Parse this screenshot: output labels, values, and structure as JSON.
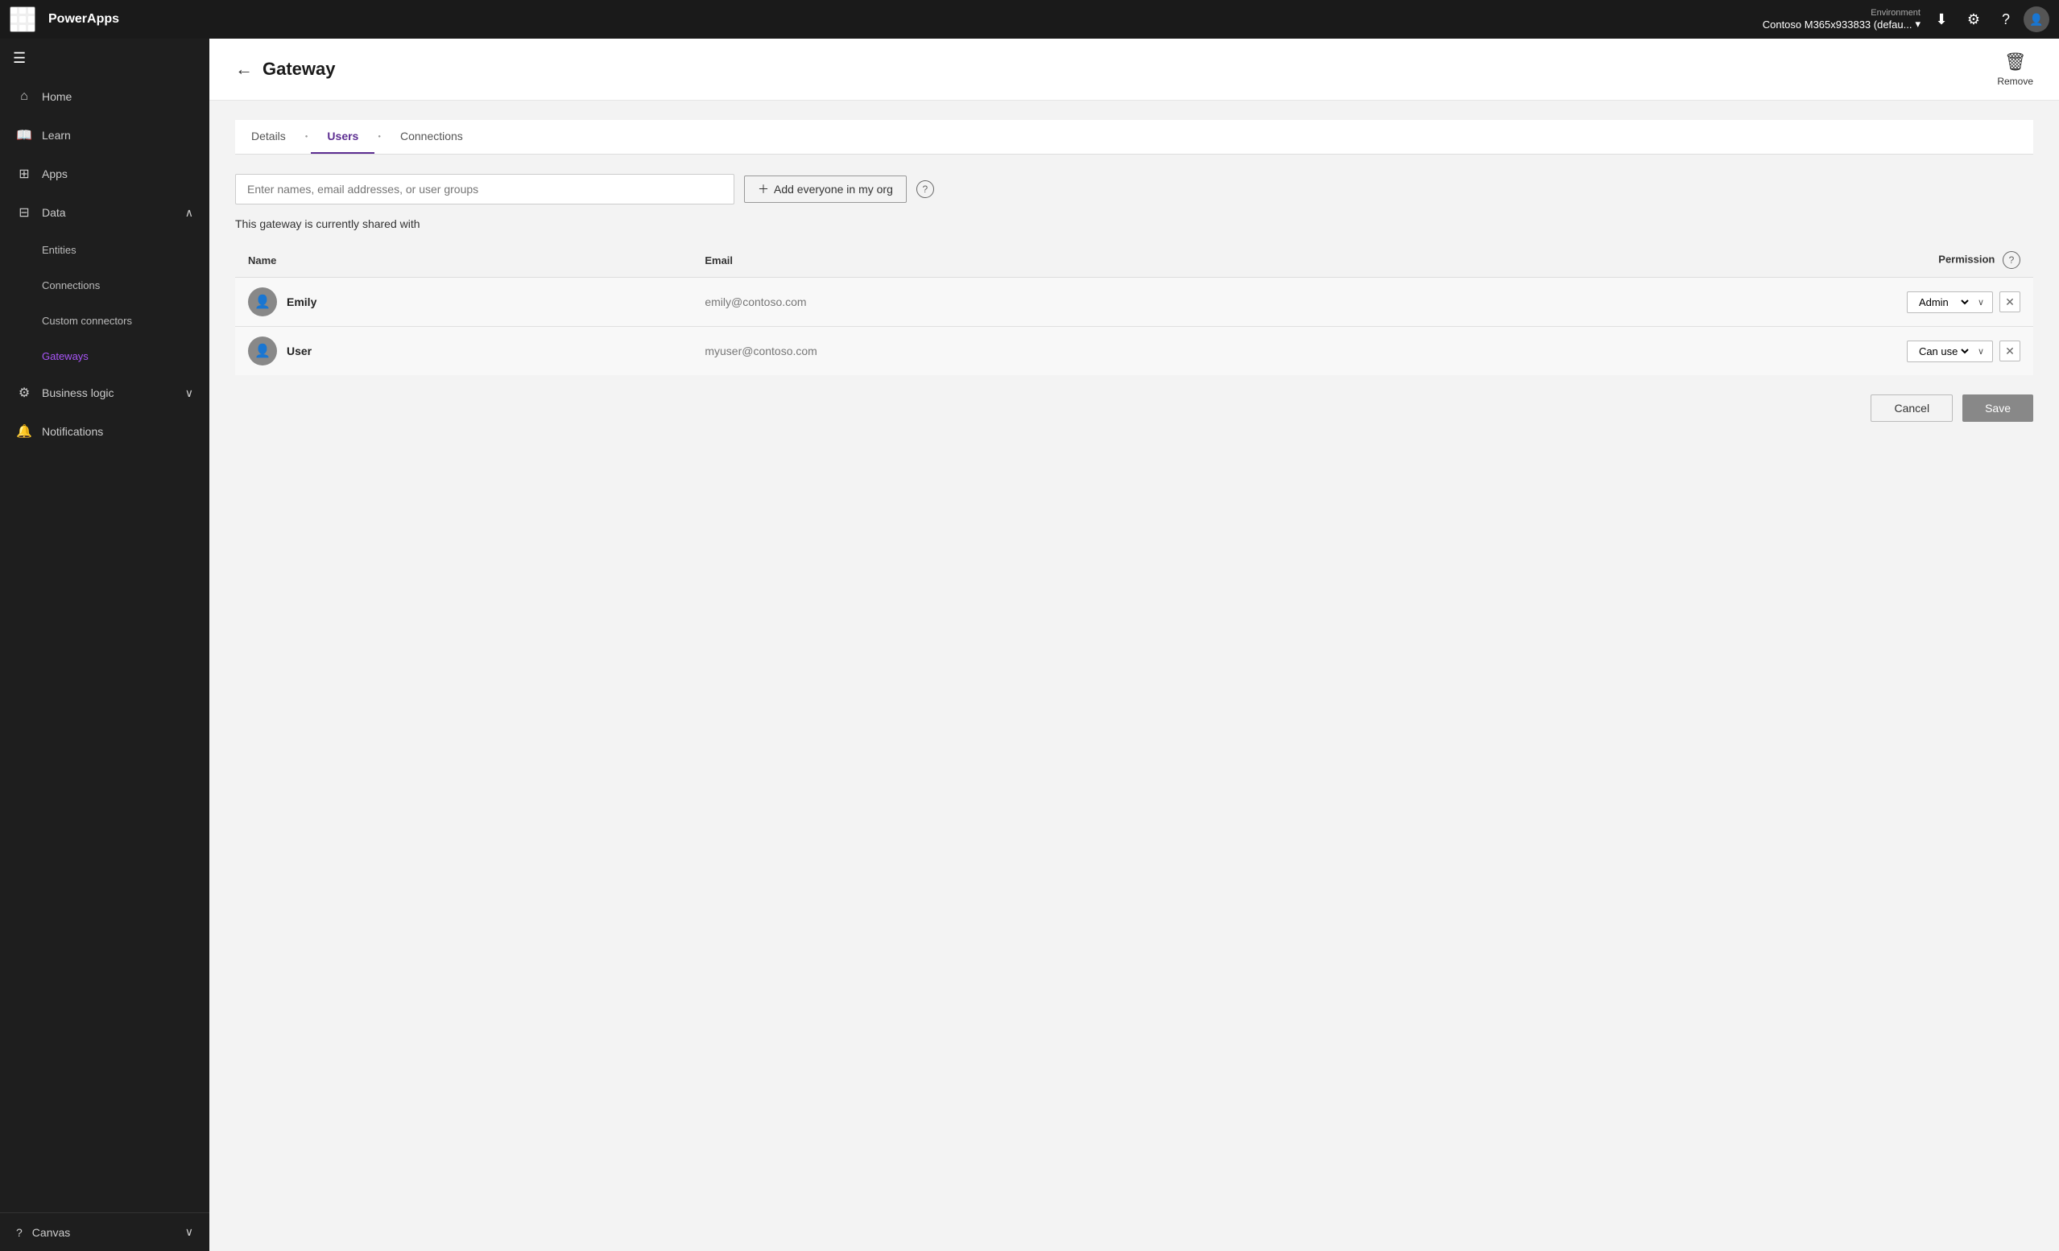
{
  "topbar": {
    "brand": "PowerApps",
    "env_label": "Environment",
    "env_name": "Contoso M365x933833 (defau...",
    "download_tooltip": "Download",
    "settings_tooltip": "Settings",
    "help_tooltip": "Help"
  },
  "sidebar": {
    "menu_icon": "☰",
    "items": [
      {
        "id": "home",
        "label": "Home",
        "icon": "⌂"
      },
      {
        "id": "learn",
        "label": "Learn",
        "icon": "📖"
      },
      {
        "id": "apps",
        "label": "Apps",
        "icon": "⊞"
      },
      {
        "id": "data",
        "label": "Data",
        "icon": "⊟",
        "expandable": true,
        "expanded": true
      },
      {
        "id": "entities",
        "label": "Entities",
        "sub": true
      },
      {
        "id": "connections",
        "label": "Connections",
        "sub": true
      },
      {
        "id": "custom-connectors",
        "label": "Custom connectors",
        "sub": true
      },
      {
        "id": "gateways",
        "label": "Gateways",
        "sub": true,
        "active": true
      },
      {
        "id": "business-logic",
        "label": "Business logic",
        "icon": "⚙",
        "expandable": true
      },
      {
        "id": "notifications",
        "label": "Notifications",
        "icon": "🔔"
      }
    ],
    "bottom": {
      "label": "Canvas",
      "icon": "?"
    }
  },
  "page": {
    "title": "Gateway",
    "back_label": "←",
    "remove_label": "Remove",
    "tabs": [
      {
        "id": "details",
        "label": "Details",
        "active": false
      },
      {
        "id": "users",
        "label": "Users",
        "active": true
      },
      {
        "id": "connections",
        "label": "Connections",
        "active": false
      }
    ],
    "search_placeholder": "Enter names, email addresses, or user groups",
    "add_everyone_label": "Add everyone in my org",
    "shared_with_label": "This gateway is currently shared with",
    "table": {
      "col_name": "Name",
      "col_email": "Email",
      "col_permission": "Permission",
      "rows": [
        {
          "id": "emily",
          "name": "Emily",
          "email": "emily@contoso.com",
          "permission": "Admin",
          "permission_options": [
            "Admin",
            "Can use"
          ]
        },
        {
          "id": "user",
          "name": "User",
          "email": "myuser@contoso.com",
          "permission": "Can use",
          "permission_options": [
            "Admin",
            "Can use"
          ]
        }
      ]
    },
    "cancel_label": "Cancel",
    "save_label": "Save"
  }
}
